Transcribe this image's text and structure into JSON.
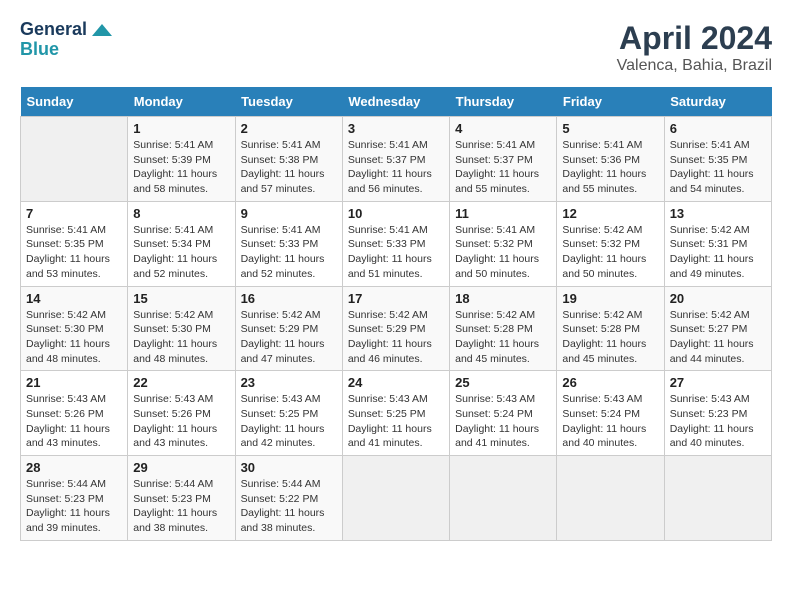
{
  "header": {
    "logo_line1": "General",
    "logo_line2": "Blue",
    "title": "April 2024",
    "subtitle": "Valenca, Bahia, Brazil"
  },
  "calendar": {
    "days_of_week": [
      "Sunday",
      "Monday",
      "Tuesday",
      "Wednesday",
      "Thursday",
      "Friday",
      "Saturday"
    ],
    "weeks": [
      [
        {
          "day": "",
          "info": ""
        },
        {
          "day": "1",
          "info": "Sunrise: 5:41 AM\nSunset: 5:39 PM\nDaylight: 11 hours\nand 58 minutes."
        },
        {
          "day": "2",
          "info": "Sunrise: 5:41 AM\nSunset: 5:38 PM\nDaylight: 11 hours\nand 57 minutes."
        },
        {
          "day": "3",
          "info": "Sunrise: 5:41 AM\nSunset: 5:37 PM\nDaylight: 11 hours\nand 56 minutes."
        },
        {
          "day": "4",
          "info": "Sunrise: 5:41 AM\nSunset: 5:37 PM\nDaylight: 11 hours\nand 55 minutes."
        },
        {
          "day": "5",
          "info": "Sunrise: 5:41 AM\nSunset: 5:36 PM\nDaylight: 11 hours\nand 55 minutes."
        },
        {
          "day": "6",
          "info": "Sunrise: 5:41 AM\nSunset: 5:35 PM\nDaylight: 11 hours\nand 54 minutes."
        }
      ],
      [
        {
          "day": "7",
          "info": "Sunrise: 5:41 AM\nSunset: 5:35 PM\nDaylight: 11 hours\nand 53 minutes."
        },
        {
          "day": "8",
          "info": "Sunrise: 5:41 AM\nSunset: 5:34 PM\nDaylight: 11 hours\nand 52 minutes."
        },
        {
          "day": "9",
          "info": "Sunrise: 5:41 AM\nSunset: 5:33 PM\nDaylight: 11 hours\nand 52 minutes."
        },
        {
          "day": "10",
          "info": "Sunrise: 5:41 AM\nSunset: 5:33 PM\nDaylight: 11 hours\nand 51 minutes."
        },
        {
          "day": "11",
          "info": "Sunrise: 5:41 AM\nSunset: 5:32 PM\nDaylight: 11 hours\nand 50 minutes."
        },
        {
          "day": "12",
          "info": "Sunrise: 5:42 AM\nSunset: 5:32 PM\nDaylight: 11 hours\nand 50 minutes."
        },
        {
          "day": "13",
          "info": "Sunrise: 5:42 AM\nSunset: 5:31 PM\nDaylight: 11 hours\nand 49 minutes."
        }
      ],
      [
        {
          "day": "14",
          "info": "Sunrise: 5:42 AM\nSunset: 5:30 PM\nDaylight: 11 hours\nand 48 minutes."
        },
        {
          "day": "15",
          "info": "Sunrise: 5:42 AM\nSunset: 5:30 PM\nDaylight: 11 hours\nand 48 minutes."
        },
        {
          "day": "16",
          "info": "Sunrise: 5:42 AM\nSunset: 5:29 PM\nDaylight: 11 hours\nand 47 minutes."
        },
        {
          "day": "17",
          "info": "Sunrise: 5:42 AM\nSunset: 5:29 PM\nDaylight: 11 hours\nand 46 minutes."
        },
        {
          "day": "18",
          "info": "Sunrise: 5:42 AM\nSunset: 5:28 PM\nDaylight: 11 hours\nand 45 minutes."
        },
        {
          "day": "19",
          "info": "Sunrise: 5:42 AM\nSunset: 5:28 PM\nDaylight: 11 hours\nand 45 minutes."
        },
        {
          "day": "20",
          "info": "Sunrise: 5:42 AM\nSunset: 5:27 PM\nDaylight: 11 hours\nand 44 minutes."
        }
      ],
      [
        {
          "day": "21",
          "info": "Sunrise: 5:43 AM\nSunset: 5:26 PM\nDaylight: 11 hours\nand 43 minutes."
        },
        {
          "day": "22",
          "info": "Sunrise: 5:43 AM\nSunset: 5:26 PM\nDaylight: 11 hours\nand 43 minutes."
        },
        {
          "day": "23",
          "info": "Sunrise: 5:43 AM\nSunset: 5:25 PM\nDaylight: 11 hours\nand 42 minutes."
        },
        {
          "day": "24",
          "info": "Sunrise: 5:43 AM\nSunset: 5:25 PM\nDaylight: 11 hours\nand 41 minutes."
        },
        {
          "day": "25",
          "info": "Sunrise: 5:43 AM\nSunset: 5:24 PM\nDaylight: 11 hours\nand 41 minutes."
        },
        {
          "day": "26",
          "info": "Sunrise: 5:43 AM\nSunset: 5:24 PM\nDaylight: 11 hours\nand 40 minutes."
        },
        {
          "day": "27",
          "info": "Sunrise: 5:43 AM\nSunset: 5:23 PM\nDaylight: 11 hours\nand 40 minutes."
        }
      ],
      [
        {
          "day": "28",
          "info": "Sunrise: 5:44 AM\nSunset: 5:23 PM\nDaylight: 11 hours\nand 39 minutes."
        },
        {
          "day": "29",
          "info": "Sunrise: 5:44 AM\nSunset: 5:23 PM\nDaylight: 11 hours\nand 38 minutes."
        },
        {
          "day": "30",
          "info": "Sunrise: 5:44 AM\nSunset: 5:22 PM\nDaylight: 11 hours\nand 38 minutes."
        },
        {
          "day": "",
          "info": ""
        },
        {
          "day": "",
          "info": ""
        },
        {
          "day": "",
          "info": ""
        },
        {
          "day": "",
          "info": ""
        }
      ]
    ]
  }
}
